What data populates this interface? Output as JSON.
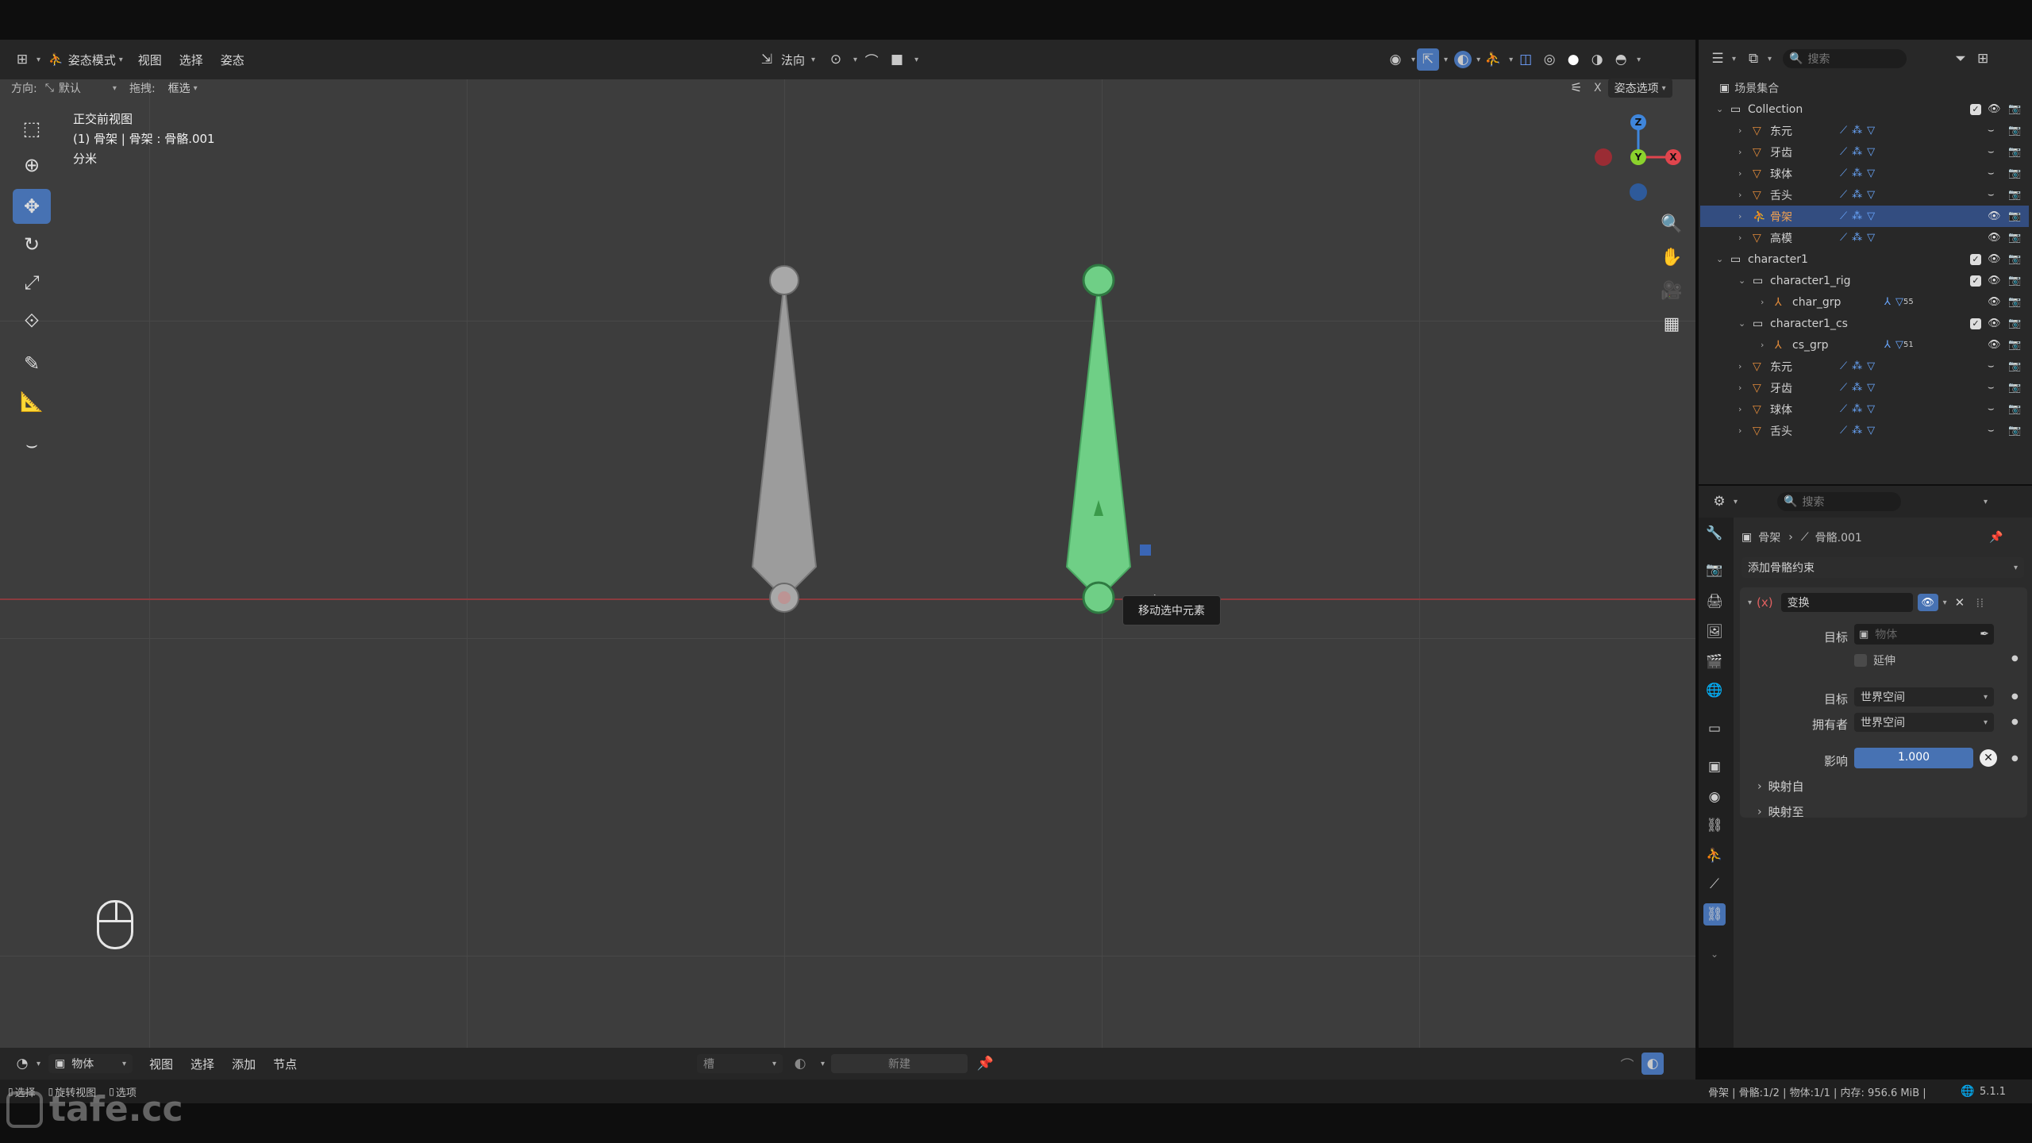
{
  "viewport_header": {
    "mode": "姿态模式",
    "menus": [
      "视图",
      "选择",
      "姿态"
    ],
    "orientation": "法向",
    "options_label": "姿态选项",
    "x_label": "X"
  },
  "tool_options": {
    "orient_label": "方向:",
    "orient_value": "默认",
    "drag_label": "拖拽:",
    "drag_value": "框选"
  },
  "viewport_info": {
    "view_name": "正交前视图",
    "object_line": "(1) 骨架 | 骨架 : 骨骼.001",
    "units": "分米"
  },
  "gizmo": {
    "z": "Z",
    "y": "Y",
    "x": "X"
  },
  "tooltip": "移动选中元素",
  "outliner": {
    "search_placeholder": "搜索",
    "scene_collection": "场景集合",
    "rows": [
      {
        "name": "Collection",
        "indent": 0,
        "type": "collection"
      },
      {
        "name": "东元",
        "indent": 1,
        "type": "mesh"
      },
      {
        "name": "牙齿",
        "indent": 1,
        "type": "mesh"
      },
      {
        "name": "球体",
        "indent": 1,
        "type": "mesh"
      },
      {
        "name": "舌头",
        "indent": 1,
        "type": "mesh"
      },
      {
        "name": "骨架",
        "indent": 1,
        "type": "armature",
        "selected": true
      },
      {
        "name": "高模",
        "indent": 1,
        "type": "mesh"
      },
      {
        "name": "character1",
        "indent": 0,
        "type": "collection"
      },
      {
        "name": "character1_rig",
        "indent": 1,
        "type": "collection"
      },
      {
        "name": "char_grp",
        "indent": 2,
        "type": "empty",
        "badge": "55"
      },
      {
        "name": "character1_cs",
        "indent": 1,
        "type": "collection"
      },
      {
        "name": "cs_grp",
        "indent": 2,
        "type": "empty",
        "badge": "51"
      },
      {
        "name": "东元",
        "indent": 1,
        "type": "mesh"
      },
      {
        "name": "牙齿",
        "indent": 1,
        "type": "mesh"
      },
      {
        "name": "球体",
        "indent": 1,
        "type": "mesh"
      },
      {
        "name": "舌头",
        "indent": 1,
        "type": "mesh"
      }
    ]
  },
  "properties": {
    "search_placeholder": "搜索",
    "breadcrumb_object": "骨架",
    "breadcrumb_bone": "骨骼.001",
    "add_constraint": "添加骨骼约束",
    "constraint_name": "变换",
    "constraint_icon": "(x)",
    "target_label": "目标",
    "target_placeholder": "物体",
    "extrapolate_label": "延伸",
    "target_space_label": "目标",
    "target_space_value": "世界空间",
    "owner_space_label": "拥有者",
    "owner_space_value": "世界空间",
    "influence_label": "影响",
    "influence_value": "1.000",
    "influence_fraction": 1.0,
    "map_from": "映射自",
    "map_to": "映射至"
  },
  "node_header": {
    "editor_type": "物体",
    "menus": [
      "视图",
      "选择",
      "添加",
      "节点"
    ],
    "slot": "槽",
    "new_button": "新建"
  },
  "statusbar": {
    "hint_select": "选择",
    "hint_rotate": "旋转视图",
    "hint_options": "选项",
    "stats": "骨架 | 骨骼:1/2 | 物体:1/1 | 内存: 956.6 MiB |",
    "version": "5.1.1"
  },
  "watermark": "tafe.cc",
  "colors": {
    "selected_bone": "#6fcf86",
    "selection_blue": "#4772b3",
    "x_axis": "#e0454d",
    "y_axis": "#8bd22d",
    "z_axis": "#3f86dc"
  }
}
